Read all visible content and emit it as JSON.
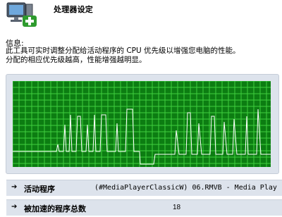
{
  "header": {
    "title": "处理器设定",
    "icon": "computer-add-icon"
  },
  "info": {
    "label": "信息:",
    "line1": "此工具可实时调整分配给活动程序的 CPU 优先级以增强您电脑的性能。",
    "line2": "分配的相应优先级越高，性能增强越明显。"
  },
  "graph": {
    "icon": "cpu-usage-graph",
    "background_color": "#0c7d12",
    "grid_color": "#3fcf3f",
    "line_color": "#ffffff"
  },
  "rows": {
    "active_program": {
      "label": "活动程序",
      "value": "(#MediaPlayerClassicW) 06.RMVB - Media Play"
    },
    "accelerated_total": {
      "label": "被加速的程序总数",
      "value": "18"
    },
    "arrow_icon": "arrow-right-icon"
  }
}
